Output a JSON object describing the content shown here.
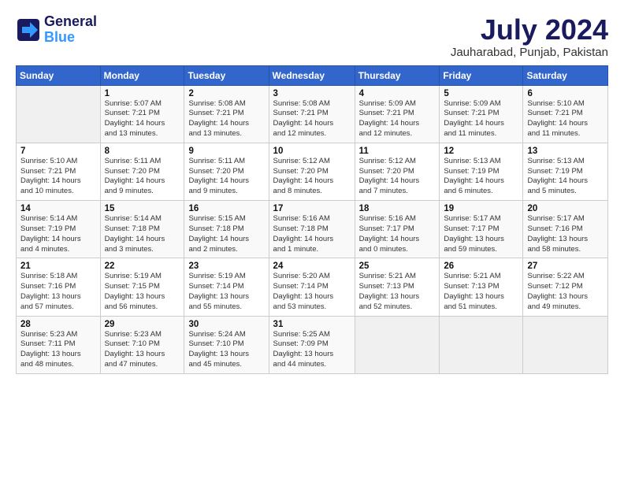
{
  "header": {
    "logo_line1": "General",
    "logo_line2": "Blue",
    "month": "July 2024",
    "location": "Jauharabad, Punjab, Pakistan"
  },
  "days_of_week": [
    "Sunday",
    "Monday",
    "Tuesday",
    "Wednesday",
    "Thursday",
    "Friday",
    "Saturday"
  ],
  "weeks": [
    [
      {
        "day": "",
        "info": ""
      },
      {
        "day": "1",
        "info": "Sunrise: 5:07 AM\nSunset: 7:21 PM\nDaylight: 14 hours\nand 13 minutes."
      },
      {
        "day": "2",
        "info": "Sunrise: 5:08 AM\nSunset: 7:21 PM\nDaylight: 14 hours\nand 13 minutes."
      },
      {
        "day": "3",
        "info": "Sunrise: 5:08 AM\nSunset: 7:21 PM\nDaylight: 14 hours\nand 12 minutes."
      },
      {
        "day": "4",
        "info": "Sunrise: 5:09 AM\nSunset: 7:21 PM\nDaylight: 14 hours\nand 12 minutes."
      },
      {
        "day": "5",
        "info": "Sunrise: 5:09 AM\nSunset: 7:21 PM\nDaylight: 14 hours\nand 11 minutes."
      },
      {
        "day": "6",
        "info": "Sunrise: 5:10 AM\nSunset: 7:21 PM\nDaylight: 14 hours\nand 11 minutes."
      }
    ],
    [
      {
        "day": "7",
        "info": "Sunrise: 5:10 AM\nSunset: 7:21 PM\nDaylight: 14 hours\nand 10 minutes."
      },
      {
        "day": "8",
        "info": "Sunrise: 5:11 AM\nSunset: 7:20 PM\nDaylight: 14 hours\nand 9 minutes."
      },
      {
        "day": "9",
        "info": "Sunrise: 5:11 AM\nSunset: 7:20 PM\nDaylight: 14 hours\nand 9 minutes."
      },
      {
        "day": "10",
        "info": "Sunrise: 5:12 AM\nSunset: 7:20 PM\nDaylight: 14 hours\nand 8 minutes."
      },
      {
        "day": "11",
        "info": "Sunrise: 5:12 AM\nSunset: 7:20 PM\nDaylight: 14 hours\nand 7 minutes."
      },
      {
        "day": "12",
        "info": "Sunrise: 5:13 AM\nSunset: 7:19 PM\nDaylight: 14 hours\nand 6 minutes."
      },
      {
        "day": "13",
        "info": "Sunrise: 5:13 AM\nSunset: 7:19 PM\nDaylight: 14 hours\nand 5 minutes."
      }
    ],
    [
      {
        "day": "14",
        "info": "Sunrise: 5:14 AM\nSunset: 7:19 PM\nDaylight: 14 hours\nand 4 minutes."
      },
      {
        "day": "15",
        "info": "Sunrise: 5:14 AM\nSunset: 7:18 PM\nDaylight: 14 hours\nand 3 minutes."
      },
      {
        "day": "16",
        "info": "Sunrise: 5:15 AM\nSunset: 7:18 PM\nDaylight: 14 hours\nand 2 minutes."
      },
      {
        "day": "17",
        "info": "Sunrise: 5:16 AM\nSunset: 7:18 PM\nDaylight: 14 hours\nand 1 minute."
      },
      {
        "day": "18",
        "info": "Sunrise: 5:16 AM\nSunset: 7:17 PM\nDaylight: 14 hours\nand 0 minutes."
      },
      {
        "day": "19",
        "info": "Sunrise: 5:17 AM\nSunset: 7:17 PM\nDaylight: 13 hours\nand 59 minutes."
      },
      {
        "day": "20",
        "info": "Sunrise: 5:17 AM\nSunset: 7:16 PM\nDaylight: 13 hours\nand 58 minutes."
      }
    ],
    [
      {
        "day": "21",
        "info": "Sunrise: 5:18 AM\nSunset: 7:16 PM\nDaylight: 13 hours\nand 57 minutes."
      },
      {
        "day": "22",
        "info": "Sunrise: 5:19 AM\nSunset: 7:15 PM\nDaylight: 13 hours\nand 56 minutes."
      },
      {
        "day": "23",
        "info": "Sunrise: 5:19 AM\nSunset: 7:14 PM\nDaylight: 13 hours\nand 55 minutes."
      },
      {
        "day": "24",
        "info": "Sunrise: 5:20 AM\nSunset: 7:14 PM\nDaylight: 13 hours\nand 53 minutes."
      },
      {
        "day": "25",
        "info": "Sunrise: 5:21 AM\nSunset: 7:13 PM\nDaylight: 13 hours\nand 52 minutes."
      },
      {
        "day": "26",
        "info": "Sunrise: 5:21 AM\nSunset: 7:13 PM\nDaylight: 13 hours\nand 51 minutes."
      },
      {
        "day": "27",
        "info": "Sunrise: 5:22 AM\nSunset: 7:12 PM\nDaylight: 13 hours\nand 49 minutes."
      }
    ],
    [
      {
        "day": "28",
        "info": "Sunrise: 5:23 AM\nSunset: 7:11 PM\nDaylight: 13 hours\nand 48 minutes."
      },
      {
        "day": "29",
        "info": "Sunrise: 5:23 AM\nSunset: 7:10 PM\nDaylight: 13 hours\nand 47 minutes."
      },
      {
        "day": "30",
        "info": "Sunrise: 5:24 AM\nSunset: 7:10 PM\nDaylight: 13 hours\nand 45 minutes."
      },
      {
        "day": "31",
        "info": "Sunrise: 5:25 AM\nSunset: 7:09 PM\nDaylight: 13 hours\nand 44 minutes."
      },
      {
        "day": "",
        "info": ""
      },
      {
        "day": "",
        "info": ""
      },
      {
        "day": "",
        "info": ""
      }
    ]
  ]
}
